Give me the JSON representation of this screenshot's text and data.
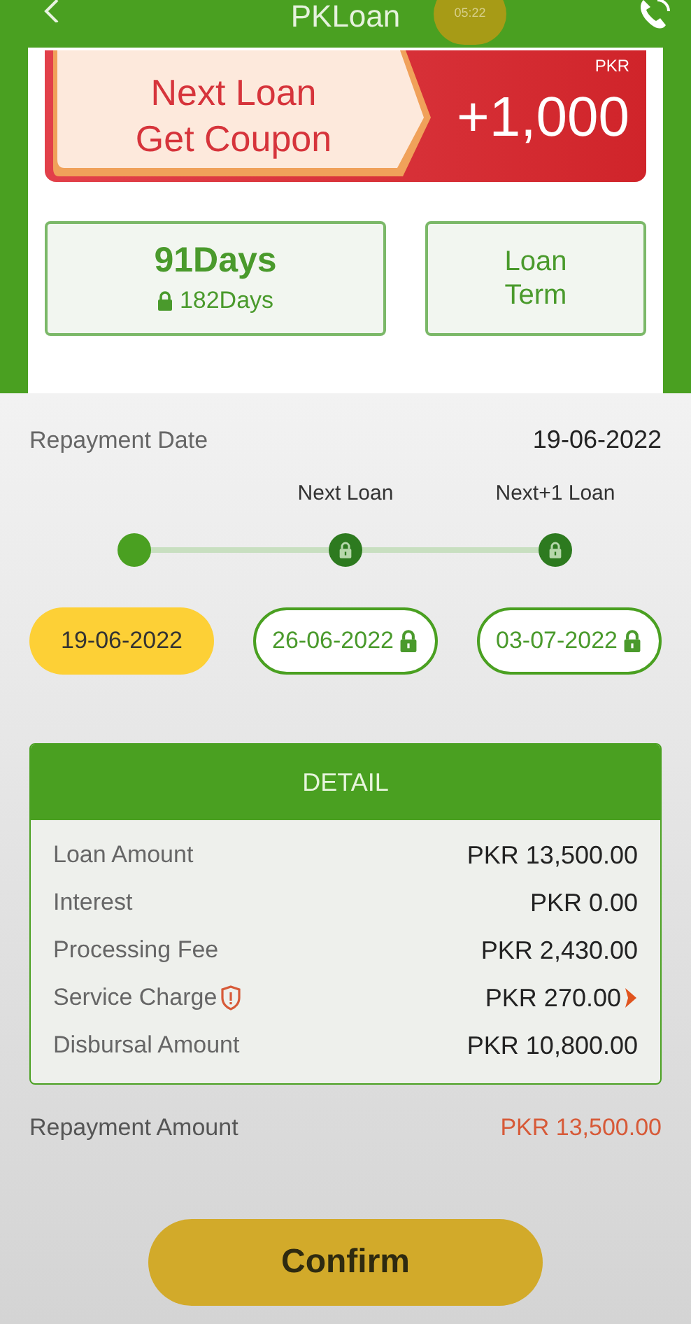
{
  "header": {
    "title": "PKLoan",
    "recording_time": "05:22"
  },
  "coupon": {
    "text": "Next Loan\nGet Coupon",
    "currency": "PKR",
    "amount": "+1,000"
  },
  "terms": [
    {
      "kind": "option",
      "label": "91Days",
      "sub": "182Days",
      "locked": true
    },
    {
      "kind": "label",
      "label": "Loan\nTerm"
    }
  ],
  "repayment_date": {
    "label": "Repayment Date",
    "value": "19-06-2022"
  },
  "schedule": [
    {
      "date": "19-06-2022",
      "selected": true,
      "locked": false
    },
    {
      "label": "Next Loan",
      "date": "26-06-2022",
      "selected": false,
      "locked": true
    },
    {
      "label": "Next+1 Loan",
      "date": "03-07-2022",
      "selected": false,
      "locked": true
    }
  ],
  "detail": {
    "title": "DETAIL",
    "rows": [
      {
        "label": "Loan Amount",
        "value": "PKR 13,500.00"
      },
      {
        "label": "Interest",
        "value": "PKR 0.00"
      },
      {
        "label": "Processing Fee",
        "value": "PKR 2,430.00"
      },
      {
        "label": "Service Charge",
        "value": "PKR 270.00",
        "info": true,
        "link": true
      },
      {
        "label": "Disbursal Amount",
        "value": "PKR 10,800.00"
      }
    ]
  },
  "repayment_amount": {
    "label": "Repayment Amount",
    "value": "PKR 13,500.00"
  },
  "confirm": "Confirm"
}
